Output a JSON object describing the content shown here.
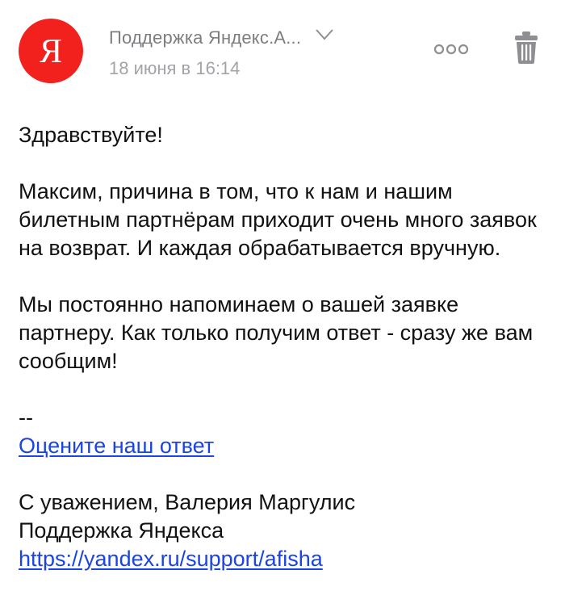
{
  "header": {
    "avatar_letter": "Я",
    "sender": "Поддержка Яндекс.А...",
    "date": "18 июня в 16:14",
    "icons": {
      "expand": "chevron-down-icon",
      "more": "more-icon",
      "delete": "trash-icon"
    },
    "colors": {
      "avatar_bg": "#f2211d",
      "link": "#1a44e6",
      "muted": "#7d7d82"
    }
  },
  "message": {
    "greeting": "Здравствуйте!",
    "paragraph1": "Максим, причина в том, что к нам и нашим билетным партнёрам приходит очень много заявок на возврат. И каждая обрабатывается вручную.",
    "paragraph2": "Мы постоянно напоминаем о вашей заявке партнеру. Как только получим ответ - сразу же вам сообщим!",
    "separator": "--",
    "rate_link": "Оцените наш ответ",
    "regards": "С уважением, Валерия Маргулис",
    "team": "Поддержка Яндекса",
    "support_url": "https://yandex.ru/support/afisha"
  }
}
